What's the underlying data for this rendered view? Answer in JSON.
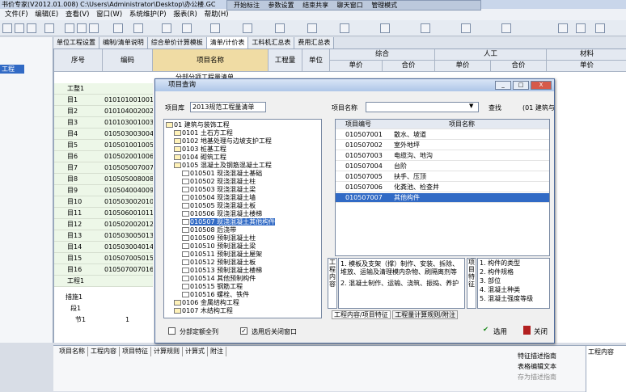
{
  "window": {
    "title": "书价专家(V2012.01.008) C:\\Users\\Administrator\\Desktop\\办公楼.GC"
  },
  "float_toolbar": {
    "items": [
      "开始标注",
      "参数设置",
      "结束共享",
      "聊天窗口",
      "管理模式"
    ]
  },
  "menu": {
    "items": [
      "文件(F)",
      "编辑(E)",
      "查看(V)",
      "窗口(W)",
      "系统维护(P)",
      "报表(R)",
      "帮助(H)"
    ]
  },
  "left_panel": {
    "item": "工程"
  },
  "tabs": {
    "items": [
      "单位工程设置",
      "编制/清单说明",
      "综合单价计算模板",
      "清单/计价表",
      "工料机汇总表",
      "费用汇总表"
    ]
  },
  "grid": {
    "headers": {
      "seq": "序号",
      "code": "编码",
      "name": "项目名称",
      "qty": "工程量",
      "unit": "单位",
      "composite": "综合",
      "labor": "人工",
      "material": "材料",
      "price": "单价",
      "total": "合价"
    },
    "rows": [
      {
        "seq": "工整1",
        "code": ""
      },
      {
        "seq": "目1",
        "code": "010101001001"
      },
      {
        "seq": "目2",
        "code": "010104002002"
      },
      {
        "seq": "目3",
        "code": "010103001003"
      },
      {
        "seq": "目4",
        "code": "010503003004"
      },
      {
        "seq": "目5",
        "code": "010501001005"
      },
      {
        "seq": "目6",
        "code": "010502001006"
      },
      {
        "seq": "目7",
        "code": "010505007007"
      },
      {
        "seq": "目8",
        "code": "010505008008"
      },
      {
        "seq": "目9",
        "code": "010504004009"
      },
      {
        "seq": "目10",
        "code": "010503002010"
      },
      {
        "seq": "目11",
        "code": "010506001011"
      },
      {
        "seq": "目12",
        "code": "010502002012"
      },
      {
        "seq": "目13",
        "code": "010503005013"
      },
      {
        "seq": "目14",
        "code": "010503004014"
      },
      {
        "seq": "目15",
        "code": "010507005015"
      },
      {
        "seq": "目16",
        "code": "010507007016"
      },
      {
        "seq": "工程1",
        "code": ""
      }
    ],
    "section_title": "分部分项工程量清单",
    "lower_rows": [
      {
        "seq": "措施1"
      },
      {
        "seq": "段1"
      },
      {
        "seq": "节1",
        "qty": "1"
      }
    ]
  },
  "bottom": {
    "tabs": [
      "项目名称",
      "工程内容",
      "项目特征",
      "计算规则",
      "计算式",
      "附注"
    ],
    "buttons": [
      "特征描述指南",
      "表格编辑文本",
      "存为描述指南"
    ],
    "right_header": "工程内容"
  },
  "dialog": {
    "title": "项目查询",
    "library_label": "项目库",
    "library_value": "2013规范工程量清单",
    "name_label": "项目名称",
    "name_value": "",
    "search_button": "查找",
    "path_text": "(01 建筑与",
    "tree": [
      {
        "level": 0,
        "text": "01 建筑与装饰工程",
        "folder": true
      },
      {
        "level": 1,
        "text": "0101 土石方工程",
        "folder": true
      },
      {
        "level": 1,
        "text": "0102 地基处理与边坡支护工程",
        "folder": true
      },
      {
        "level": 1,
        "text": "0103 桩基工程",
        "folder": true
      },
      {
        "level": 1,
        "text": "0104 砌筑工程",
        "folder": true
      },
      {
        "level": 1,
        "text": "0105 混凝土及钢筋混凝土工程",
        "folder": true
      },
      {
        "level": 2,
        "text": "010501 现浇混凝土基础"
      },
      {
        "level": 2,
        "text": "010502 现浇混凝土柱"
      },
      {
        "level": 2,
        "text": "010503 现浇混凝土梁"
      },
      {
        "level": 2,
        "text": "010504 现浇混凝土墙"
      },
      {
        "level": 2,
        "text": "010505 现浇混凝土板"
      },
      {
        "level": 2,
        "text": "010506 现浇混凝土楼梯"
      },
      {
        "level": 2,
        "text": "010507 现浇混凝土其他构件",
        "selected": true
      },
      {
        "level": 2,
        "text": "010508 后浇带"
      },
      {
        "level": 2,
        "text": "010509 预制混凝土柱"
      },
      {
        "level": 2,
        "text": "010510 预制混凝土梁"
      },
      {
        "level": 2,
        "text": "010511 预制混凝土屋架"
      },
      {
        "level": 2,
        "text": "010512 预制混凝土板"
      },
      {
        "level": 2,
        "text": "010513 预制混凝土楼梯"
      },
      {
        "level": 2,
        "text": "010514 其他预制构件"
      },
      {
        "level": 2,
        "text": "010515 钢筋工程"
      },
      {
        "level": 2,
        "text": "010516 螺栓、铁件"
      },
      {
        "level": 1,
        "text": "0106 金属结构工程",
        "folder": true
      },
      {
        "level": 1,
        "text": "0107 木结构工程",
        "folder": true
      }
    ],
    "list_headers": {
      "code": "项目编号",
      "name": "项目名称"
    },
    "list_rows": [
      {
        "code": "010507001",
        "name": "散水、坡道"
      },
      {
        "code": "010507002",
        "name": "室外地坪"
      },
      {
        "code": "010507003",
        "name": "电缆沟、地沟"
      },
      {
        "code": "010507004",
        "name": "台阶"
      },
      {
        "code": "010507005",
        "name": "扶手、压顶"
      },
      {
        "code": "010507006",
        "name": "化粪池、检查井"
      },
      {
        "code": "010507007",
        "name": "其他构件",
        "selected": true
      }
    ],
    "work_label": "工程内容",
    "work_content": [
      "1. 模板及支架（撑）制作、安装、拆除、堆放、运输及清理模内杂物、刷隔离剂等",
      "2. 混凝土制作、运输、浇筑、振捣、养护"
    ],
    "feature_label": "项目特征",
    "features": [
      "1. 构件的类型",
      "2. 构件规格",
      "3. 部位",
      "4. 混凝土种类",
      "5. 混凝土强度等级"
    ],
    "bottom_tabs": [
      "工程内容/项目特征",
      "工程量计算规则/附注"
    ],
    "checkbox1": "分部定额全列",
    "checkbox2": "选用后关闭窗口",
    "select_button": "选用",
    "close_button": "关闭"
  }
}
